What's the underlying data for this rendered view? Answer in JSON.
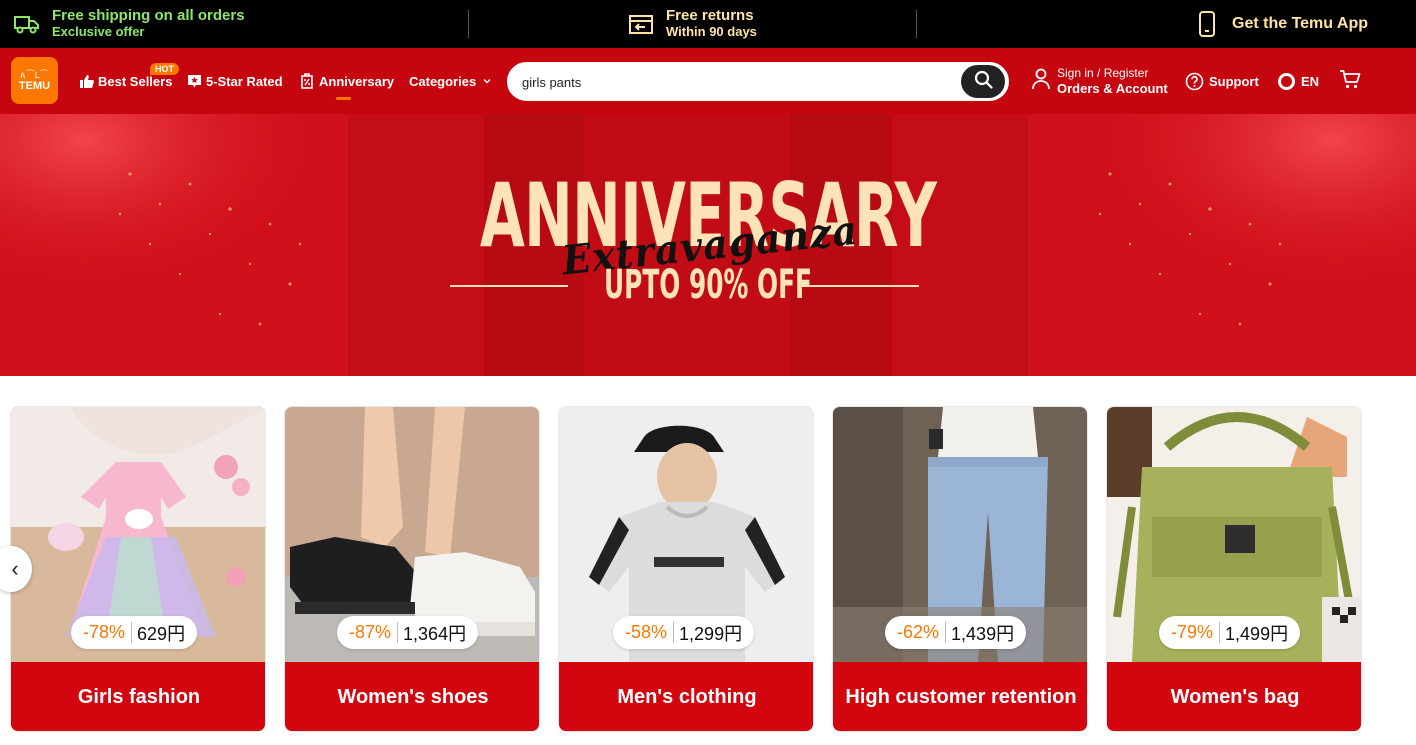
{
  "topbar": {
    "shipping_title": "Free shipping on all orders",
    "shipping_sub": "Exclusive offer",
    "returns_title": "Free returns",
    "returns_sub": "Within 90 days",
    "app_label": "Get the Temu App"
  },
  "header": {
    "logo_glyphs": "ጰ⁀ᒪ⁀",
    "logo_text": "TEMU",
    "nav": [
      {
        "label": "Best Sellers",
        "icon": "thumbs-up-icon"
      },
      {
        "label": "5-Star Rated",
        "icon": "star-badge-icon"
      },
      {
        "label": "Anniversary",
        "icon": "percent-tag-icon"
      },
      {
        "label": "Categories",
        "icon": "chevron-down-icon"
      }
    ],
    "hot_badge": "HOT",
    "search": {
      "value": "girls pants",
      "placeholder": ""
    },
    "account_line1": "Sign in / Register",
    "account_line2": "Orders & Account",
    "support": "Support",
    "language": "EN"
  },
  "banner": {
    "title": "ANNIVERSARY",
    "script": "Extravaganza",
    "subtitle": "UPTO 90% OFF"
  },
  "cards": [
    {
      "label": "Girls fashion",
      "discount": "-78%",
      "price": "629円"
    },
    {
      "label": "Women's shoes",
      "discount": "-87%",
      "price": "1,364円"
    },
    {
      "label": "Men's clothing",
      "discount": "-58%",
      "price": "1,299円"
    },
    {
      "label": "High customer retention",
      "discount": "-62%",
      "price": "1,439円"
    },
    {
      "label": "Women's bag",
      "discount": "-79%",
      "price": "1,499円"
    }
  ],
  "carousel": {
    "prev_glyph": "‹"
  },
  "colors": {
    "brand_orange": "#fb7701",
    "header_red": "#c5060e",
    "card_red": "#d3050f",
    "promo_green": "#8ee66a"
  }
}
